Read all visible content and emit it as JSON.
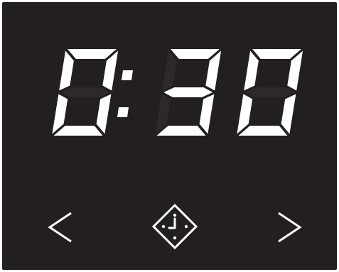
{
  "display": {
    "time": "0:30",
    "digits": [
      "0",
      "3",
      "0"
    ],
    "segment_color": "#ffffff",
    "background_color": "#231f20"
  },
  "controls": {
    "prev": {
      "icon": "chevron-left-icon"
    },
    "clock": {
      "icon": "clock-icon"
    },
    "next": {
      "icon": "chevron-right-icon"
    }
  }
}
